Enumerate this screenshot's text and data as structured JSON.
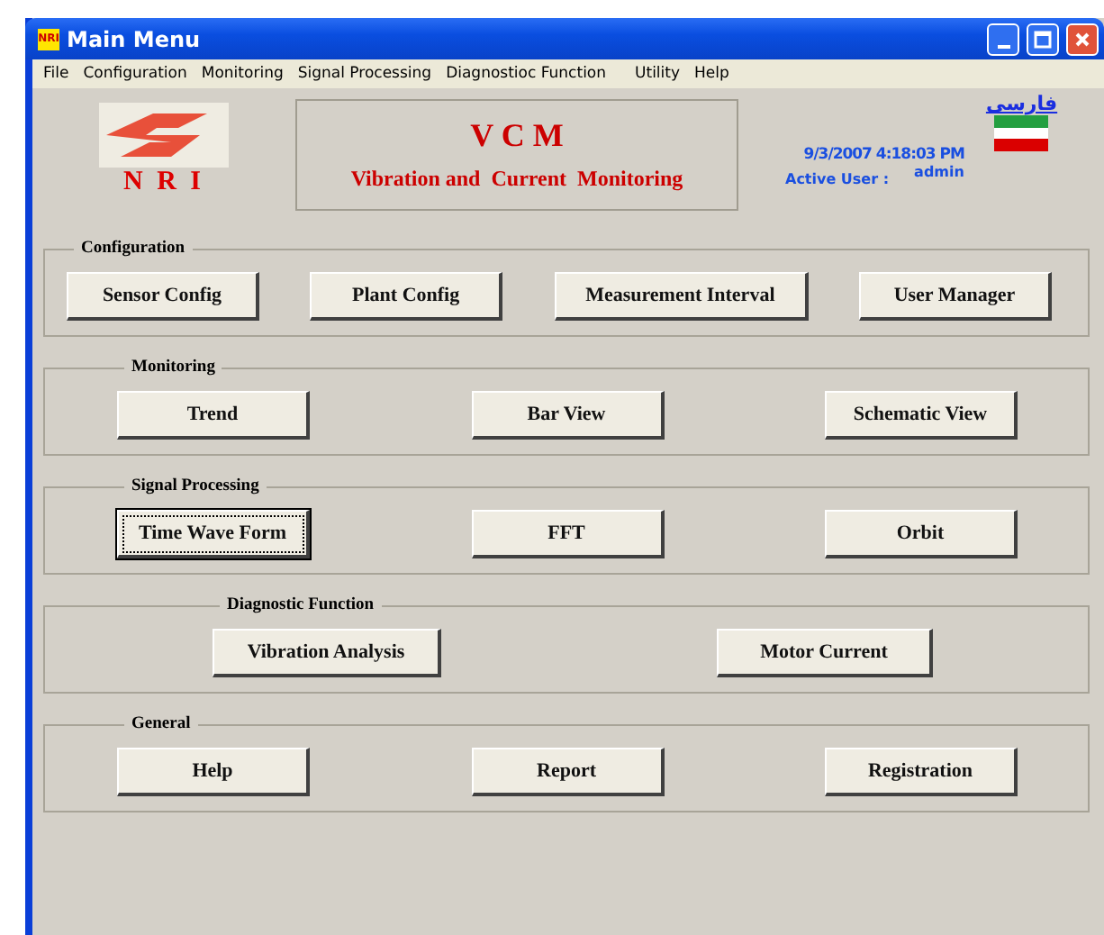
{
  "window": {
    "title": "Main Menu",
    "app_icon": "NRI"
  },
  "menu": [
    "File",
    "Configuration",
    "Monitoring",
    "Signal Processing",
    "Diagnostioc Function",
    "Utility",
    "Help"
  ],
  "logo": {
    "text": "N R I"
  },
  "banner": {
    "title": "V C M",
    "subtitle": "Vibration and  Current  Monitoring"
  },
  "language_link": "فارسی",
  "datetime": "9/3/2007 4:18:03 PM",
  "active_user": {
    "label": "Active User :",
    "value": "admin"
  },
  "groups": [
    {
      "title": "Configuration",
      "buttons": [
        {
          "label": "Sensor Config",
          "focused": false
        },
        {
          "label": "Plant Config",
          "focused": false
        },
        {
          "label": "Measurement Interval",
          "focused": false
        },
        {
          "label": "User Manager",
          "focused": false
        }
      ]
    },
    {
      "title": "Monitoring",
      "buttons": [
        {
          "label": "Trend",
          "focused": false
        },
        {
          "label": "Bar View",
          "focused": false
        },
        {
          "label": "Schematic View",
          "focused": false
        }
      ]
    },
    {
      "title": "Signal Processing",
      "buttons": [
        {
          "label": "Time Wave Form",
          "focused": true
        },
        {
          "label": "FFT",
          "focused": false
        },
        {
          "label": "Orbit",
          "focused": false
        }
      ]
    },
    {
      "title": "Diagnostic Function",
      "buttons": [
        {
          "label": "Vibration Analysis",
          "focused": false
        },
        {
          "label": "Motor Current",
          "focused": false
        }
      ]
    },
    {
      "title": "General",
      "buttons": [
        {
          "label": "Help",
          "focused": false
        },
        {
          "label": "Report",
          "focused": false
        },
        {
          "label": "Registration",
          "focused": false
        }
      ]
    }
  ]
}
